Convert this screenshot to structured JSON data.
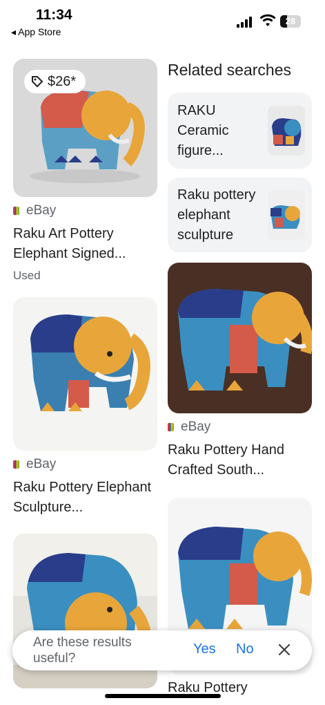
{
  "status_bar": {
    "time": "11:34",
    "back_label": "◂ App Store",
    "battery": "28"
  },
  "left_column": {
    "results": [
      {
        "price": "$26*",
        "source": "eBay",
        "title": "Raku Art Pottery Elephant Signed...",
        "condition": "Used"
      },
      {
        "source": "eBay",
        "title": "Raku Pottery Elephant Sculpture..."
      }
    ]
  },
  "related": {
    "heading": "Related searches",
    "items": [
      {
        "label": "RAKU Ceramic figure..."
      },
      {
        "label": "Raku pottery elephant sculpture"
      }
    ]
  },
  "right_column": {
    "results": [
      {
        "source": "eBay",
        "title": "Raku Pottery Hand Crafted South..."
      },
      {
        "title": "Raku Pottery"
      }
    ]
  },
  "feedback": {
    "question": "Are these results useful?",
    "yes": "Yes",
    "no": "No"
  },
  "colors": {
    "accent": "#1a73e8",
    "chip_bg": "#f1f3f4",
    "muted": "#5f6368"
  }
}
